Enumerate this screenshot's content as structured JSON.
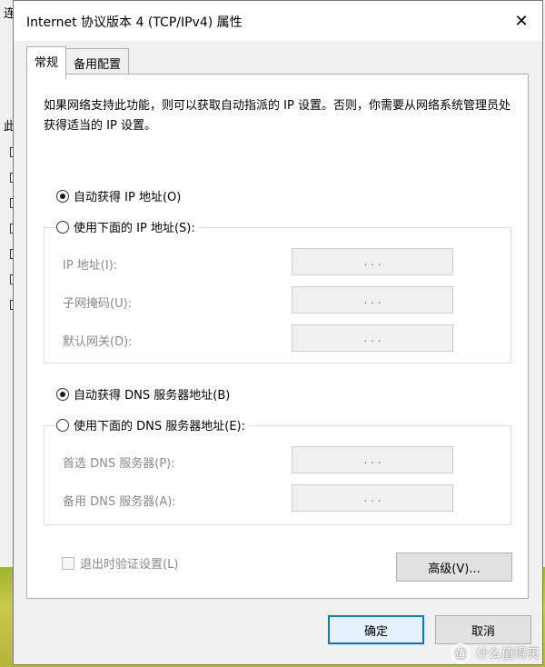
{
  "background_window": {
    "fragments": [
      "连",
      "此"
    ]
  },
  "dialog": {
    "title": "Internet 协议版本 4 (TCP/IPv4) 属性",
    "close_glyph": "✕",
    "tabs": [
      {
        "label": "常规",
        "active": true
      },
      {
        "label": "备用配置",
        "active": false
      }
    ],
    "description": "如果网络支持此功能，则可以获取自动指派的 IP 设置。否则，你需要从网络系统管理员处获得适当的 IP 设置。",
    "ip_section": {
      "auto_label": "自动获得 IP 地址(O)",
      "manual_label": "使用下面的 IP 地址(S):",
      "selected": "auto",
      "fields": [
        {
          "label": "IP 地址(I):",
          "value": ". . ."
        },
        {
          "label": "子网掩码(U):",
          "value": ". . ."
        },
        {
          "label": "默认网关(D):",
          "value": ". . ."
        }
      ]
    },
    "dns_section": {
      "auto_label": "自动获得 DNS 服务器地址(B)",
      "manual_label": "使用下面的 DNS 服务器地址(E):",
      "selected": "auto",
      "fields": [
        {
          "label": "首选 DNS 服务器(P):",
          "value": ". . ."
        },
        {
          "label": "备用 DNS 服务器(A):",
          "value": ". . ."
        }
      ]
    },
    "validate_checkbox_label": "退出时验证设置(L)",
    "advanced_button": "高级(V)...",
    "ok_button": "确定",
    "cancel_button": "取消"
  },
  "watermark": {
    "logo_text": "值",
    "text": "什么值得买"
  },
  "colors": {
    "accent": "#0078d7",
    "dialog_bg": "#f0f0f0",
    "panel_bg": "#ffffff",
    "disabled_text": "#8a8a8a"
  }
}
